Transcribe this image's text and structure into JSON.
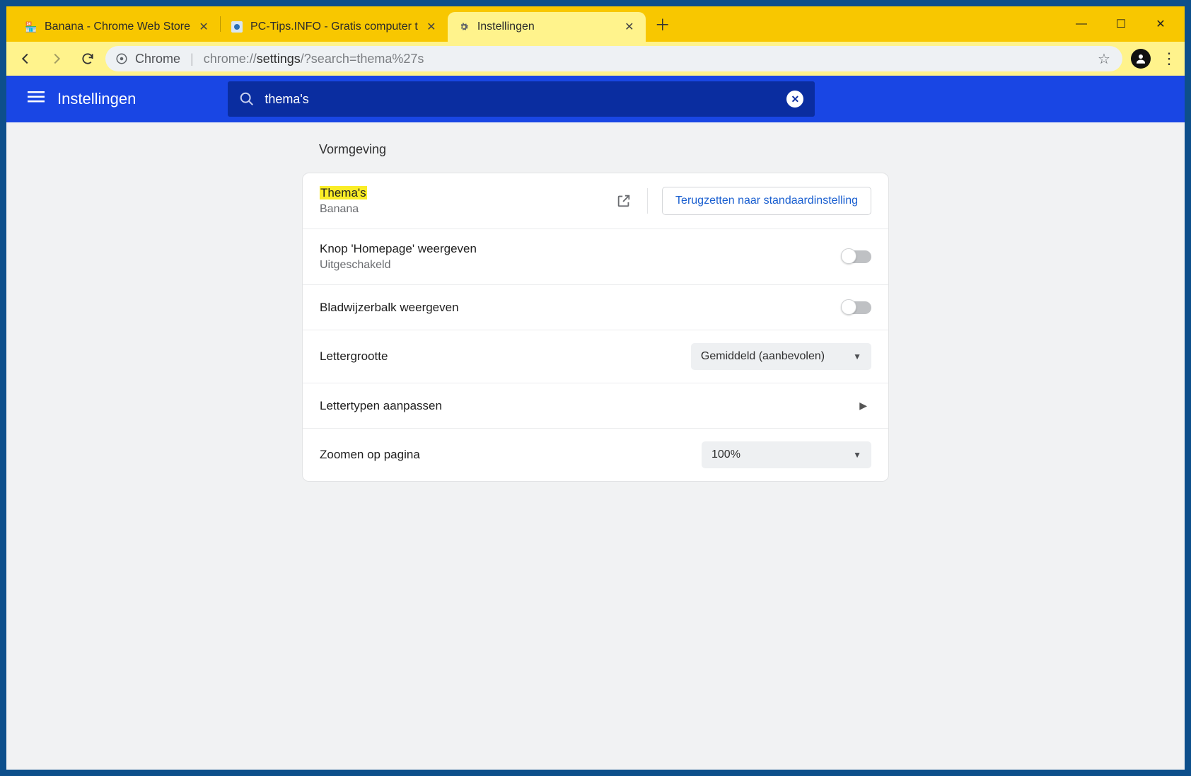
{
  "tabs": [
    {
      "title": "Banana - Chrome Web Store",
      "active": false
    },
    {
      "title": "PC-Tips.INFO - Gratis computer t",
      "active": false
    },
    {
      "title": "Instellingen",
      "active": true
    }
  ],
  "omnibox": {
    "label": "Chrome",
    "url_prefix": "chrome://",
    "url_bold": "settings",
    "url_suffix": "/?search=thema%27s"
  },
  "header": {
    "title": "Instellingen",
    "search_value": "thema's"
  },
  "section": {
    "title": "Vormgeving",
    "rows": {
      "themes": {
        "label": "Thema's",
        "sub": "Banana",
        "reset": "Terugzetten naar standaardinstelling"
      },
      "homepage": {
        "label": "Knop 'Homepage' weergeven",
        "sub": "Uitgeschakeld"
      },
      "bookmarks": {
        "label": "Bladwijzerbalk weergeven"
      },
      "fontsize": {
        "label": "Lettergrootte",
        "value": "Gemiddeld (aanbevolen)"
      },
      "fonts": {
        "label": "Lettertypen aanpassen"
      },
      "zoom": {
        "label": "Zoomen op pagina",
        "value": "100%"
      }
    }
  }
}
